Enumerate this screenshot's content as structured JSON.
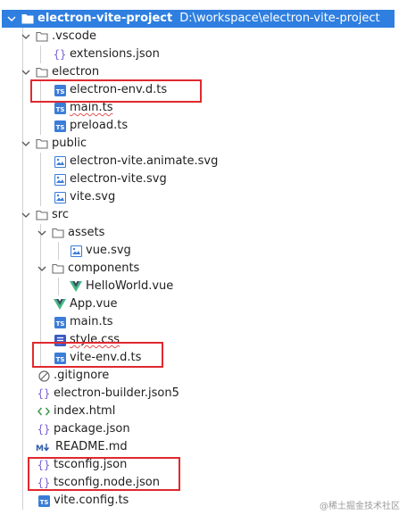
{
  "tree": {
    "root": {
      "label": "electron-vite-project",
      "path": "D:\\workspace\\electron-vite-project"
    },
    "items": [
      {
        "label": ".vscode"
      },
      {
        "label": "extensions.json"
      },
      {
        "label": "electron"
      },
      {
        "label": "electron-env.d.ts"
      },
      {
        "label": "main.ts"
      },
      {
        "label": "preload.ts"
      },
      {
        "label": "public"
      },
      {
        "label": "electron-vite.animate.svg"
      },
      {
        "label": "electron-vite.svg"
      },
      {
        "label": "vite.svg"
      },
      {
        "label": "src"
      },
      {
        "label": "assets"
      },
      {
        "label": "vue.svg"
      },
      {
        "label": "components"
      },
      {
        "label": "HelloWorld.vue"
      },
      {
        "label": "App.vue"
      },
      {
        "label": "main.ts"
      },
      {
        "label": "style.css"
      },
      {
        "label": "vite-env.d.ts"
      },
      {
        "label": ".gitignore"
      },
      {
        "label": "electron-builder.json5"
      },
      {
        "label": "index.html"
      },
      {
        "label": "package.json"
      },
      {
        "label": "README.md"
      },
      {
        "label": "tsconfig.json"
      },
      {
        "label": "tsconfig.node.json"
      },
      {
        "label": "vite.config.ts"
      }
    ]
  },
  "watermark": "@稀土掘金技术社区",
  "colors": {
    "selection": "#2f7fe0",
    "highlight_box": "#e0292e",
    "ts_icon": "#3b7dd8",
    "vue_icon": "#41b883",
    "json_icon": "#7b61d1"
  }
}
